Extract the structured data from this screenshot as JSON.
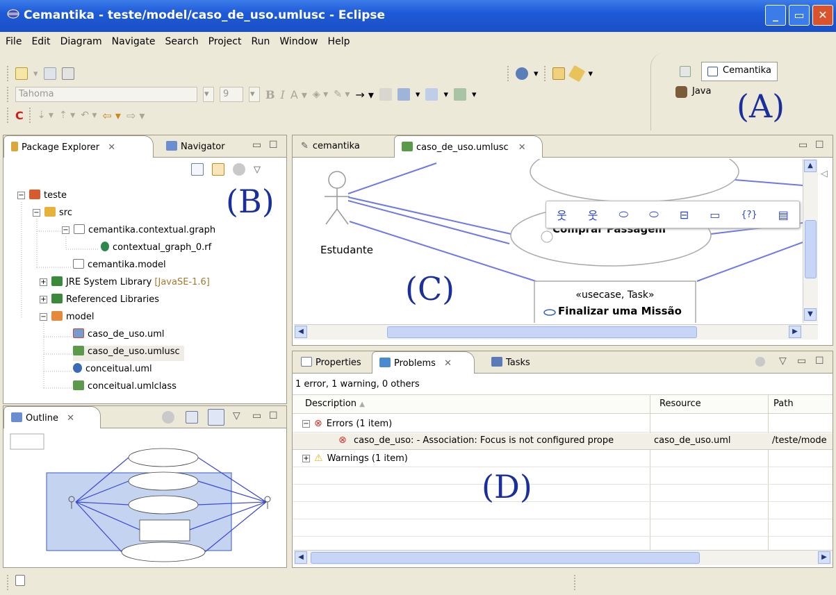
{
  "window": {
    "title": "Cemantika - teste/model/caso_de_uso.umlusc - Eclipse"
  },
  "menu": [
    "File",
    "Edit",
    "Diagram",
    "Navigate",
    "Search",
    "Project",
    "Run",
    "Window",
    "Help"
  ],
  "toolbar": {
    "font_name": "Tahoma",
    "font_size": "9"
  },
  "perspectives": {
    "active": "Cemantika",
    "other": "Java"
  },
  "callouts": {
    "a": "(A)",
    "b": "(B)",
    "c": "(C)",
    "d": "(D)"
  },
  "package_explorer": {
    "tabs": [
      "Package Explorer",
      "Navigator"
    ],
    "tree": [
      {
        "label": "teste"
      },
      {
        "label": "src"
      },
      {
        "label": "cemantika.contextual.graph"
      },
      {
        "label": "contextual_graph_0.rf"
      },
      {
        "label": "cemantika.model"
      },
      {
        "label": "JRE System Library",
        "suffix": "[JavaSE-1.6]"
      },
      {
        "label": "Referenced Libraries"
      },
      {
        "label": "model"
      },
      {
        "label": "caso_de_uso.uml"
      },
      {
        "label": "caso_de_uso.umlusc"
      },
      {
        "label": "conceitual.uml"
      },
      {
        "label": "conceitual.umlclass"
      }
    ]
  },
  "outline": {
    "tab": "Outline"
  },
  "editor": {
    "tabs": [
      "cemantika",
      "caso_de_uso.umlusc"
    ],
    "actor_label": "Estudante",
    "usecase_buy": "Comprar Passagem",
    "usecase_stereotype": "«usecase, Task»",
    "usecase_finish": "Finalizar uma Missão",
    "palette_text": "{?}"
  },
  "bottom_panel": {
    "tabs": [
      "Properties",
      "Problems",
      "Tasks"
    ],
    "summary": "1 error, 1 warning, 0 others",
    "columns": [
      "Description",
      "Resource",
      "Path"
    ],
    "rows": [
      {
        "description": "Errors (1 item)",
        "resource": "",
        "path": ""
      },
      {
        "description": "caso_de_uso: - Association: Focus is not configured prope",
        "resource": "caso_de_uso.uml",
        "path": "/teste/mode"
      },
      {
        "description": "Warnings (1 item)",
        "resource": "",
        "path": ""
      }
    ]
  },
  "colors": {
    "title_bar": "#1e5ad8",
    "callout": "#1a2f9c",
    "association_line": "#6e78e8",
    "error": "#d9322c",
    "warning": "#e8b41a"
  }
}
